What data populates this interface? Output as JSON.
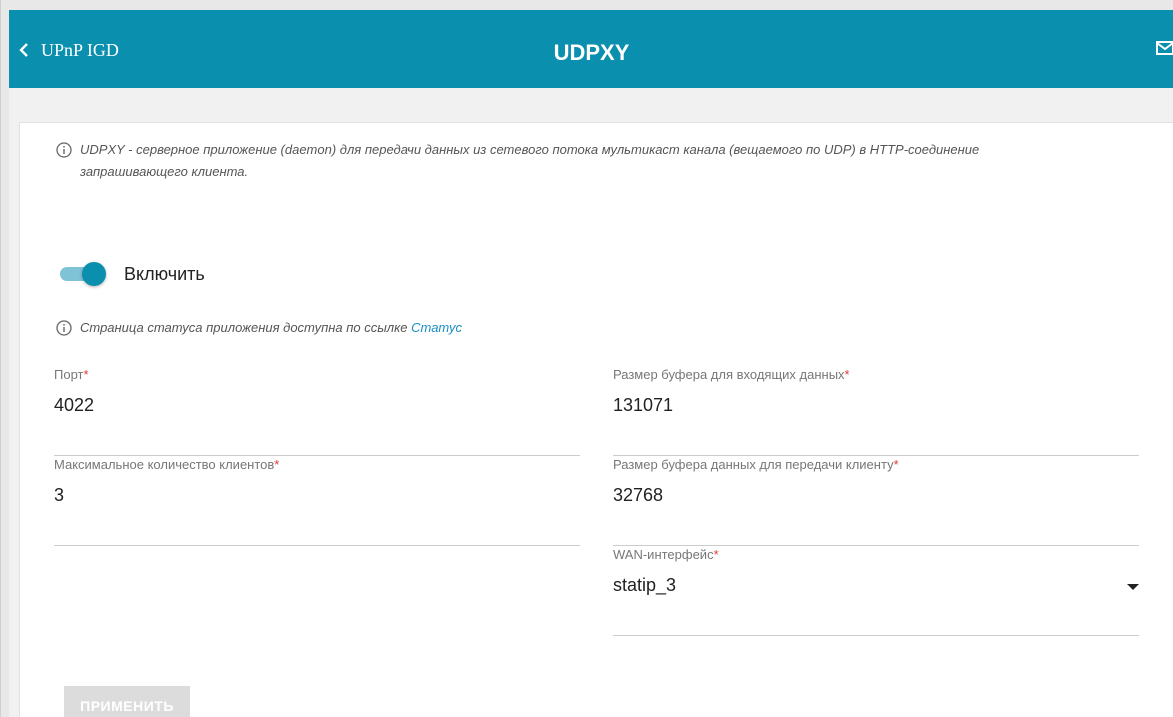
{
  "header": {
    "back_label": "UPnP IGD",
    "title": "UDPXY"
  },
  "info": {
    "description": "UDPXY - серверное приложение (daemon) для передачи данных из сетевого потока мультикаст канала (вещаемого по UDP) в HTTP-соединение запрашивающего клиента.",
    "status_text": "Страница статуса приложения доступна по ссылке ",
    "status_link": "Статус"
  },
  "toggle": {
    "label": "Включить",
    "enabled": true
  },
  "fields": {
    "port": {
      "label": "Порт",
      "required": "*",
      "value": "4022"
    },
    "max_clients": {
      "label": "Максимальное количество клиентов",
      "required": "*",
      "value": "3"
    },
    "in_buffer": {
      "label": "Размер буфера для входящих данных",
      "required": "*",
      "value": "131071"
    },
    "out_buffer": {
      "label": "Размер буфера данных для передачи клиенту",
      "required": "*",
      "value": "32768"
    },
    "wan": {
      "label": "WAN-интерфейс",
      "required": "*",
      "value": "statip_3"
    }
  },
  "buttons": {
    "apply": "ПРИМЕНИТЬ"
  },
  "colors": {
    "header_bg": "#0a8fae",
    "accent": "#0a8fae",
    "link": "#1a8fc4",
    "required": "#e53935",
    "button_disabled": "#dcdcdc"
  }
}
